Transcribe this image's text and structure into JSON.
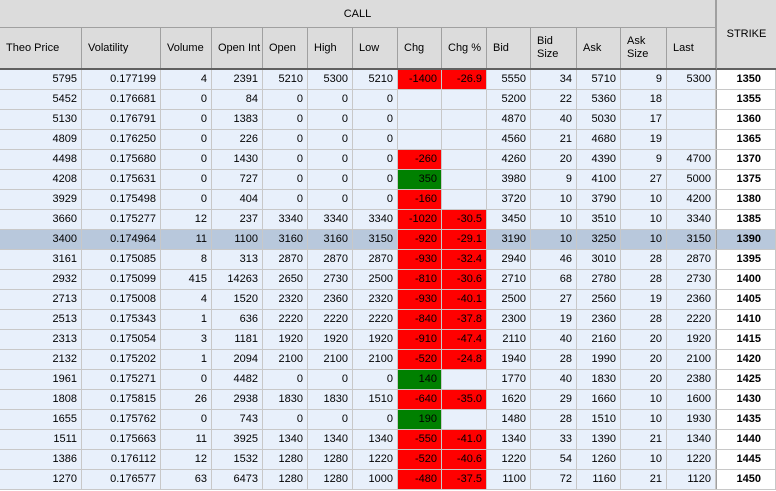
{
  "header": {
    "group_label": "CALL",
    "strike_label": "STRIKE",
    "columns": [
      "Theo Price",
      "Volatility",
      "Volume",
      "Open Int",
      "Open",
      "High",
      "Low",
      "Chg",
      "Chg %",
      "Bid",
      "Bid\nSize",
      "Ask",
      "Ask\nSize",
      "Last"
    ]
  },
  "colors": {
    "negative": "#ff0000",
    "positive": "#008000",
    "row_bg": "#e8f0fb",
    "selected_row_bg": "#b8c8dc"
  },
  "selected_row_index": 8,
  "rows": [
    {
      "theo": "5795",
      "vol": "0.177199",
      "volume": "4",
      "oi": "2391",
      "open": "5210",
      "high": "5300",
      "low": "5210",
      "chg": "-1400",
      "chgpct": "-26.9",
      "bid": "5550",
      "bidsize": "34",
      "ask": "5710",
      "asksize": "9",
      "last": "5300",
      "strike": "1350",
      "chg_color": "red",
      "pct_color": "red"
    },
    {
      "theo": "5452",
      "vol": "0.176681",
      "volume": "0",
      "oi": "84",
      "open": "0",
      "high": "0",
      "low": "0",
      "chg": "",
      "chgpct": "",
      "bid": "5200",
      "bidsize": "22",
      "ask": "5360",
      "asksize": "18",
      "last": "",
      "strike": "1355",
      "chg_color": "",
      "pct_color": ""
    },
    {
      "theo": "5130",
      "vol": "0.176791",
      "volume": "0",
      "oi": "1383",
      "open": "0",
      "high": "0",
      "low": "0",
      "chg": "",
      "chgpct": "",
      "bid": "4870",
      "bidsize": "40",
      "ask": "5030",
      "asksize": "17",
      "last": "",
      "strike": "1360",
      "chg_color": "",
      "pct_color": ""
    },
    {
      "theo": "4809",
      "vol": "0.176250",
      "volume": "0",
      "oi": "226",
      "open": "0",
      "high": "0",
      "low": "0",
      "chg": "",
      "chgpct": "",
      "bid": "4560",
      "bidsize": "21",
      "ask": "4680",
      "asksize": "19",
      "last": "",
      "strike": "1365",
      "chg_color": "",
      "pct_color": ""
    },
    {
      "theo": "4498",
      "vol": "0.175680",
      "volume": "0",
      "oi": "1430",
      "open": "0",
      "high": "0",
      "low": "0",
      "chg": "-260",
      "chgpct": "",
      "bid": "4260",
      "bidsize": "20",
      "ask": "4390",
      "asksize": "9",
      "last": "4700",
      "strike": "1370",
      "chg_color": "red",
      "pct_color": ""
    },
    {
      "theo": "4208",
      "vol": "0.175631",
      "volume": "0",
      "oi": "727",
      "open": "0",
      "high": "0",
      "low": "0",
      "chg": "350",
      "chgpct": "",
      "bid": "3980",
      "bidsize": "9",
      "ask": "4100",
      "asksize": "27",
      "last": "5000",
      "strike": "1375",
      "chg_color": "green",
      "pct_color": ""
    },
    {
      "theo": "3929",
      "vol": "0.175498",
      "volume": "0",
      "oi": "404",
      "open": "0",
      "high": "0",
      "low": "0",
      "chg": "-160",
      "chgpct": "",
      "bid": "3720",
      "bidsize": "10",
      "ask": "3790",
      "asksize": "10",
      "last": "4200",
      "strike": "1380",
      "chg_color": "red",
      "pct_color": ""
    },
    {
      "theo": "3660",
      "vol": "0.175277",
      "volume": "12",
      "oi": "237",
      "open": "3340",
      "high": "3340",
      "low": "3340",
      "chg": "-1020",
      "chgpct": "-30.5",
      "bid": "3450",
      "bidsize": "10",
      "ask": "3510",
      "asksize": "10",
      "last": "3340",
      "strike": "1385",
      "chg_color": "red",
      "pct_color": "red"
    },
    {
      "theo": "3400",
      "vol": "0.174964",
      "volume": "11",
      "oi": "1100",
      "open": "3160",
      "high": "3160",
      "low": "3150",
      "chg": "-920",
      "chgpct": "-29.1",
      "bid": "3190",
      "bidsize": "10",
      "ask": "3250",
      "asksize": "10",
      "last": "3150",
      "strike": "1390",
      "chg_color": "red",
      "pct_color": "red"
    },
    {
      "theo": "3161",
      "vol": "0.175085",
      "volume": "8",
      "oi": "313",
      "open": "2870",
      "high": "2870",
      "low": "2870",
      "chg": "-930",
      "chgpct": "-32.4",
      "bid": "2940",
      "bidsize": "46",
      "ask": "3010",
      "asksize": "28",
      "last": "2870",
      "strike": "1395",
      "chg_color": "red",
      "pct_color": "red"
    },
    {
      "theo": "2932",
      "vol": "0.175099",
      "volume": "415",
      "oi": "14263",
      "open": "2650",
      "high": "2730",
      "low": "2500",
      "chg": "-810",
      "chgpct": "-30.6",
      "bid": "2710",
      "bidsize": "68",
      "ask": "2780",
      "asksize": "28",
      "last": "2730",
      "strike": "1400",
      "chg_color": "red",
      "pct_color": "red"
    },
    {
      "theo": "2713",
      "vol": "0.175008",
      "volume": "4",
      "oi": "1520",
      "open": "2320",
      "high": "2360",
      "low": "2320",
      "chg": "-930",
      "chgpct": "-40.1",
      "bid": "2500",
      "bidsize": "27",
      "ask": "2560",
      "asksize": "19",
      "last": "2360",
      "strike": "1405",
      "chg_color": "red",
      "pct_color": "red"
    },
    {
      "theo": "2513",
      "vol": "0.175343",
      "volume": "1",
      "oi": "636",
      "open": "2220",
      "high": "2220",
      "low": "2220",
      "chg": "-840",
      "chgpct": "-37.8",
      "bid": "2300",
      "bidsize": "19",
      "ask": "2360",
      "asksize": "28",
      "last": "2220",
      "strike": "1410",
      "chg_color": "red",
      "pct_color": "red"
    },
    {
      "theo": "2313",
      "vol": "0.175054",
      "volume": "3",
      "oi": "1181",
      "open": "1920",
      "high": "1920",
      "low": "1920",
      "chg": "-910",
      "chgpct": "-47.4",
      "bid": "2110",
      "bidsize": "40",
      "ask": "2160",
      "asksize": "20",
      "last": "1920",
      "strike": "1415",
      "chg_color": "red",
      "pct_color": "red"
    },
    {
      "theo": "2132",
      "vol": "0.175202",
      "volume": "1",
      "oi": "2094",
      "open": "2100",
      "high": "2100",
      "low": "2100",
      "chg": "-520",
      "chgpct": "-24.8",
      "bid": "1940",
      "bidsize": "28",
      "ask": "1990",
      "asksize": "20",
      "last": "2100",
      "strike": "1420",
      "chg_color": "red",
      "pct_color": "red"
    },
    {
      "theo": "1961",
      "vol": "0.175271",
      "volume": "0",
      "oi": "4482",
      "open": "0",
      "high": "0",
      "low": "0",
      "chg": "140",
      "chgpct": "",
      "bid": "1770",
      "bidsize": "40",
      "ask": "1830",
      "asksize": "20",
      "last": "2380",
      "strike": "1425",
      "chg_color": "green",
      "pct_color": ""
    },
    {
      "theo": "1808",
      "vol": "0.175815",
      "volume": "26",
      "oi": "2938",
      "open": "1830",
      "high": "1830",
      "low": "1510",
      "chg": "-640",
      "chgpct": "-35.0",
      "bid": "1620",
      "bidsize": "29",
      "ask": "1660",
      "asksize": "10",
      "last": "1600",
      "strike": "1430",
      "chg_color": "red",
      "pct_color": "red"
    },
    {
      "theo": "1655",
      "vol": "0.175762",
      "volume": "0",
      "oi": "743",
      "open": "0",
      "high": "0",
      "low": "0",
      "chg": "190",
      "chgpct": "",
      "bid": "1480",
      "bidsize": "28",
      "ask": "1510",
      "asksize": "10",
      "last": "1930",
      "strike": "1435",
      "chg_color": "green",
      "pct_color": ""
    },
    {
      "theo": "1511",
      "vol": "0.175663",
      "volume": "11",
      "oi": "3925",
      "open": "1340",
      "high": "1340",
      "low": "1340",
      "chg": "-550",
      "chgpct": "-41.0",
      "bid": "1340",
      "bidsize": "33",
      "ask": "1390",
      "asksize": "21",
      "last": "1340",
      "strike": "1440",
      "chg_color": "red",
      "pct_color": "red"
    },
    {
      "theo": "1386",
      "vol": "0.176112",
      "volume": "12",
      "oi": "1532",
      "open": "1280",
      "high": "1280",
      "low": "1220",
      "chg": "-520",
      "chgpct": "-40.6",
      "bid": "1220",
      "bidsize": "54",
      "ask": "1260",
      "asksize": "10",
      "last": "1220",
      "strike": "1445",
      "chg_color": "red",
      "pct_color": "red"
    },
    {
      "theo": "1270",
      "vol": "0.176577",
      "volume": "63",
      "oi": "6473",
      "open": "1280",
      "high": "1280",
      "low": "1000",
      "chg": "-480",
      "chgpct": "-37.5",
      "bid": "1100",
      "bidsize": "72",
      "ask": "1160",
      "asksize": "21",
      "last": "1120",
      "strike": "1450",
      "chg_color": "red",
      "pct_color": "red"
    }
  ]
}
